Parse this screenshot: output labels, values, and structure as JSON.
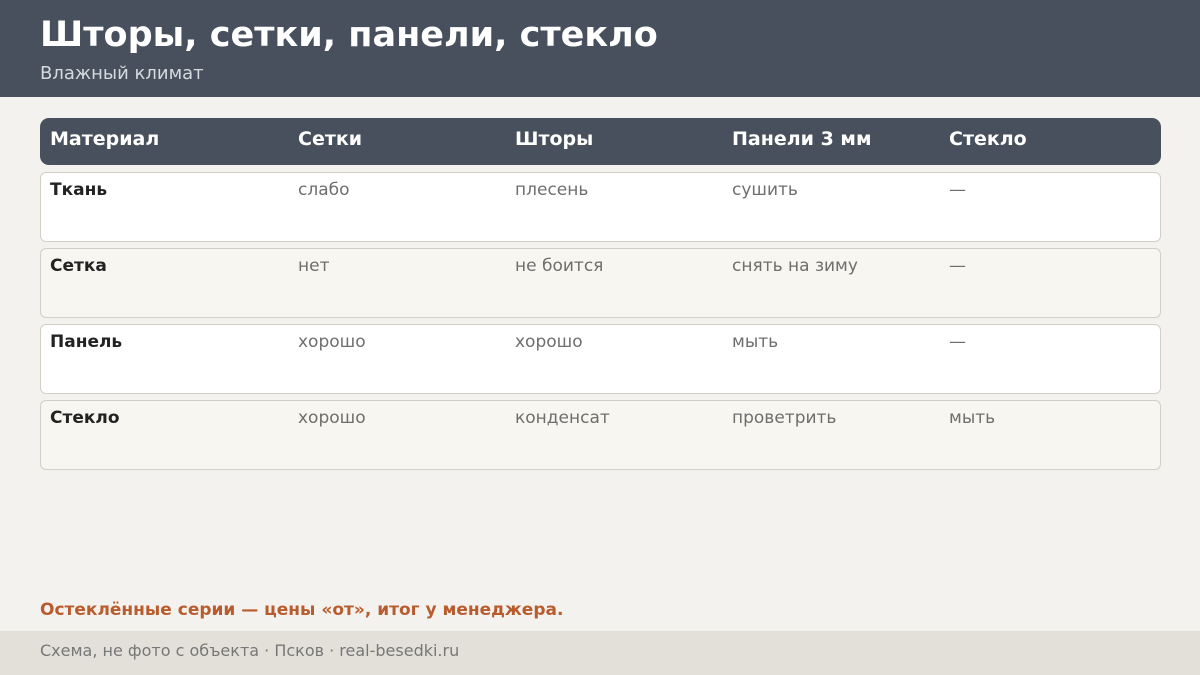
{
  "header": {
    "title": "Шторы, сетки, панели, стекло",
    "subtitle": "Влажный климат"
  },
  "table": {
    "columns": [
      "Материал",
      "Сетки",
      "Шторы",
      "Панели 3 мм",
      "Стекло"
    ],
    "rows": [
      [
        "Ткань",
        "слабо",
        "плесень",
        "сушить",
        "—"
      ],
      [
        "Сетка",
        "нет",
        "не боится",
        "снять на зиму",
        "—"
      ],
      [
        "Панель",
        "хорошо",
        "хорошо",
        "мыть",
        "—"
      ],
      [
        "Стекло",
        "хорошо",
        "конденсат",
        "проветрить",
        "мыть"
      ]
    ]
  },
  "note": "Остеклённые серии — цены «от», итог у менеджера.",
  "footer": {
    "text": "Схема, не фото с объекта  ·  Псков  ·  real-besedki.ru"
  },
  "colors": {
    "header_bg": "#47505c",
    "accent": "#b85c2e",
    "page_bg": "#f4f2ee"
  }
}
